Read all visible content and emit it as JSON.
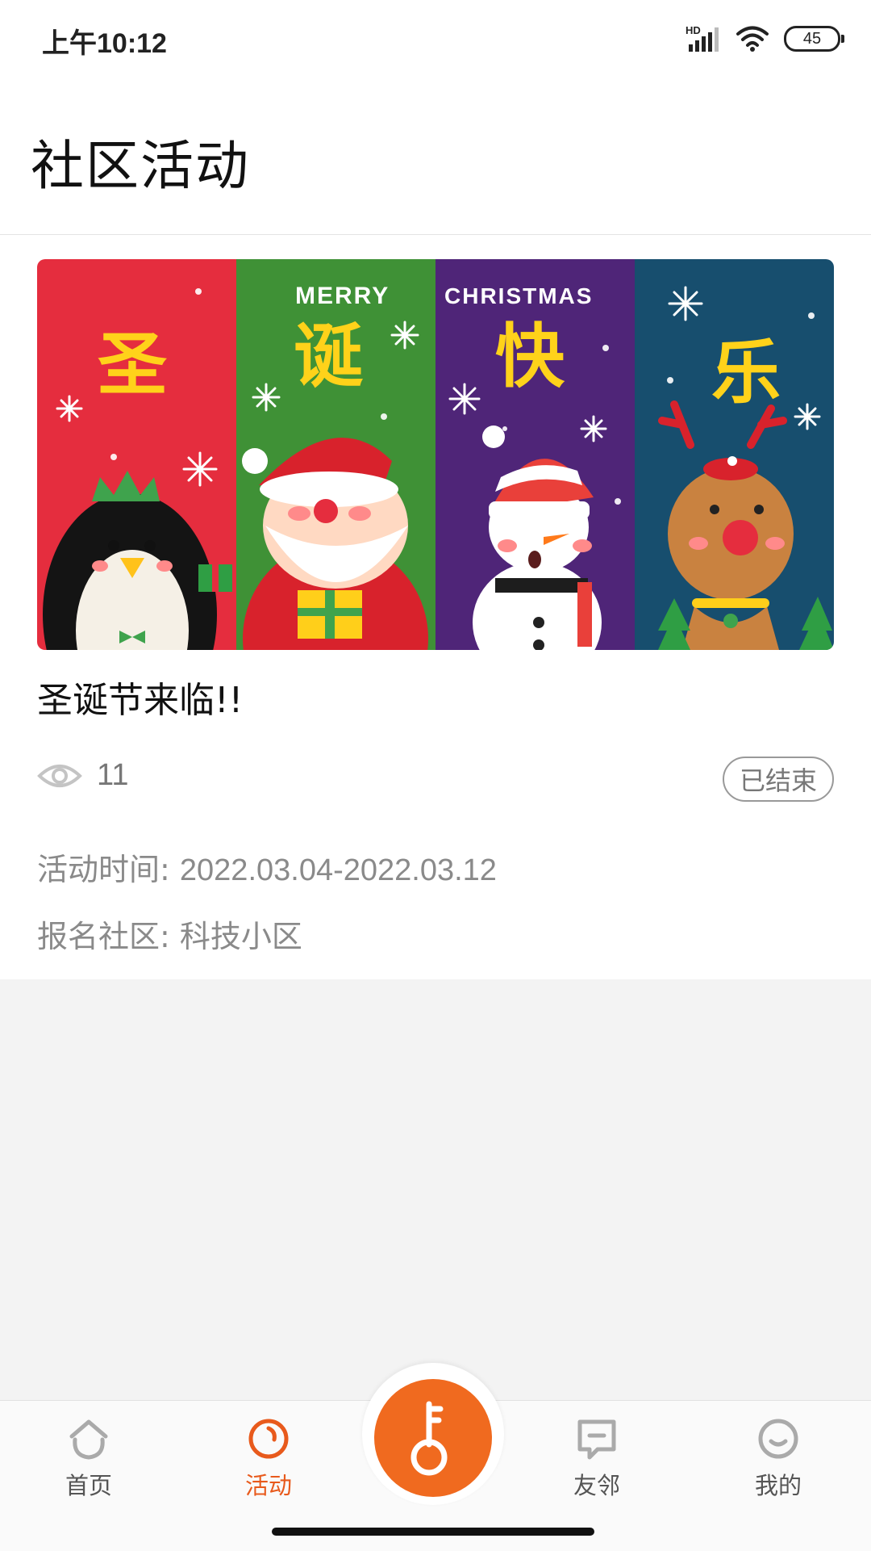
{
  "status_bar": {
    "time": "上午10:12",
    "network_label": "HD",
    "battery": "45",
    "icons": [
      "signal-icon",
      "wifi-icon",
      "battery-icon"
    ]
  },
  "header": {
    "title": "社区活动"
  },
  "activity": {
    "banner": {
      "words": [
        "MERRY",
        "CHRISTMAS"
      ],
      "chars": [
        "圣",
        "诞",
        "快",
        "乐"
      ],
      "panel_colors": [
        "#e52d3e",
        "#3f9136",
        "#4f2578",
        "#174e6e"
      ]
    },
    "title": "圣诞节来临!!",
    "views": "11",
    "status": "已结束",
    "time_label": "活动时间:",
    "time_value": "2022.03.04-2022.03.12",
    "community_label": "报名社区:",
    "community_value": "科技小区"
  },
  "tabbar": {
    "accent": "#f06a1f",
    "home": "首页",
    "activity": "活动",
    "neighbors": "友邻",
    "mine": "我的"
  }
}
